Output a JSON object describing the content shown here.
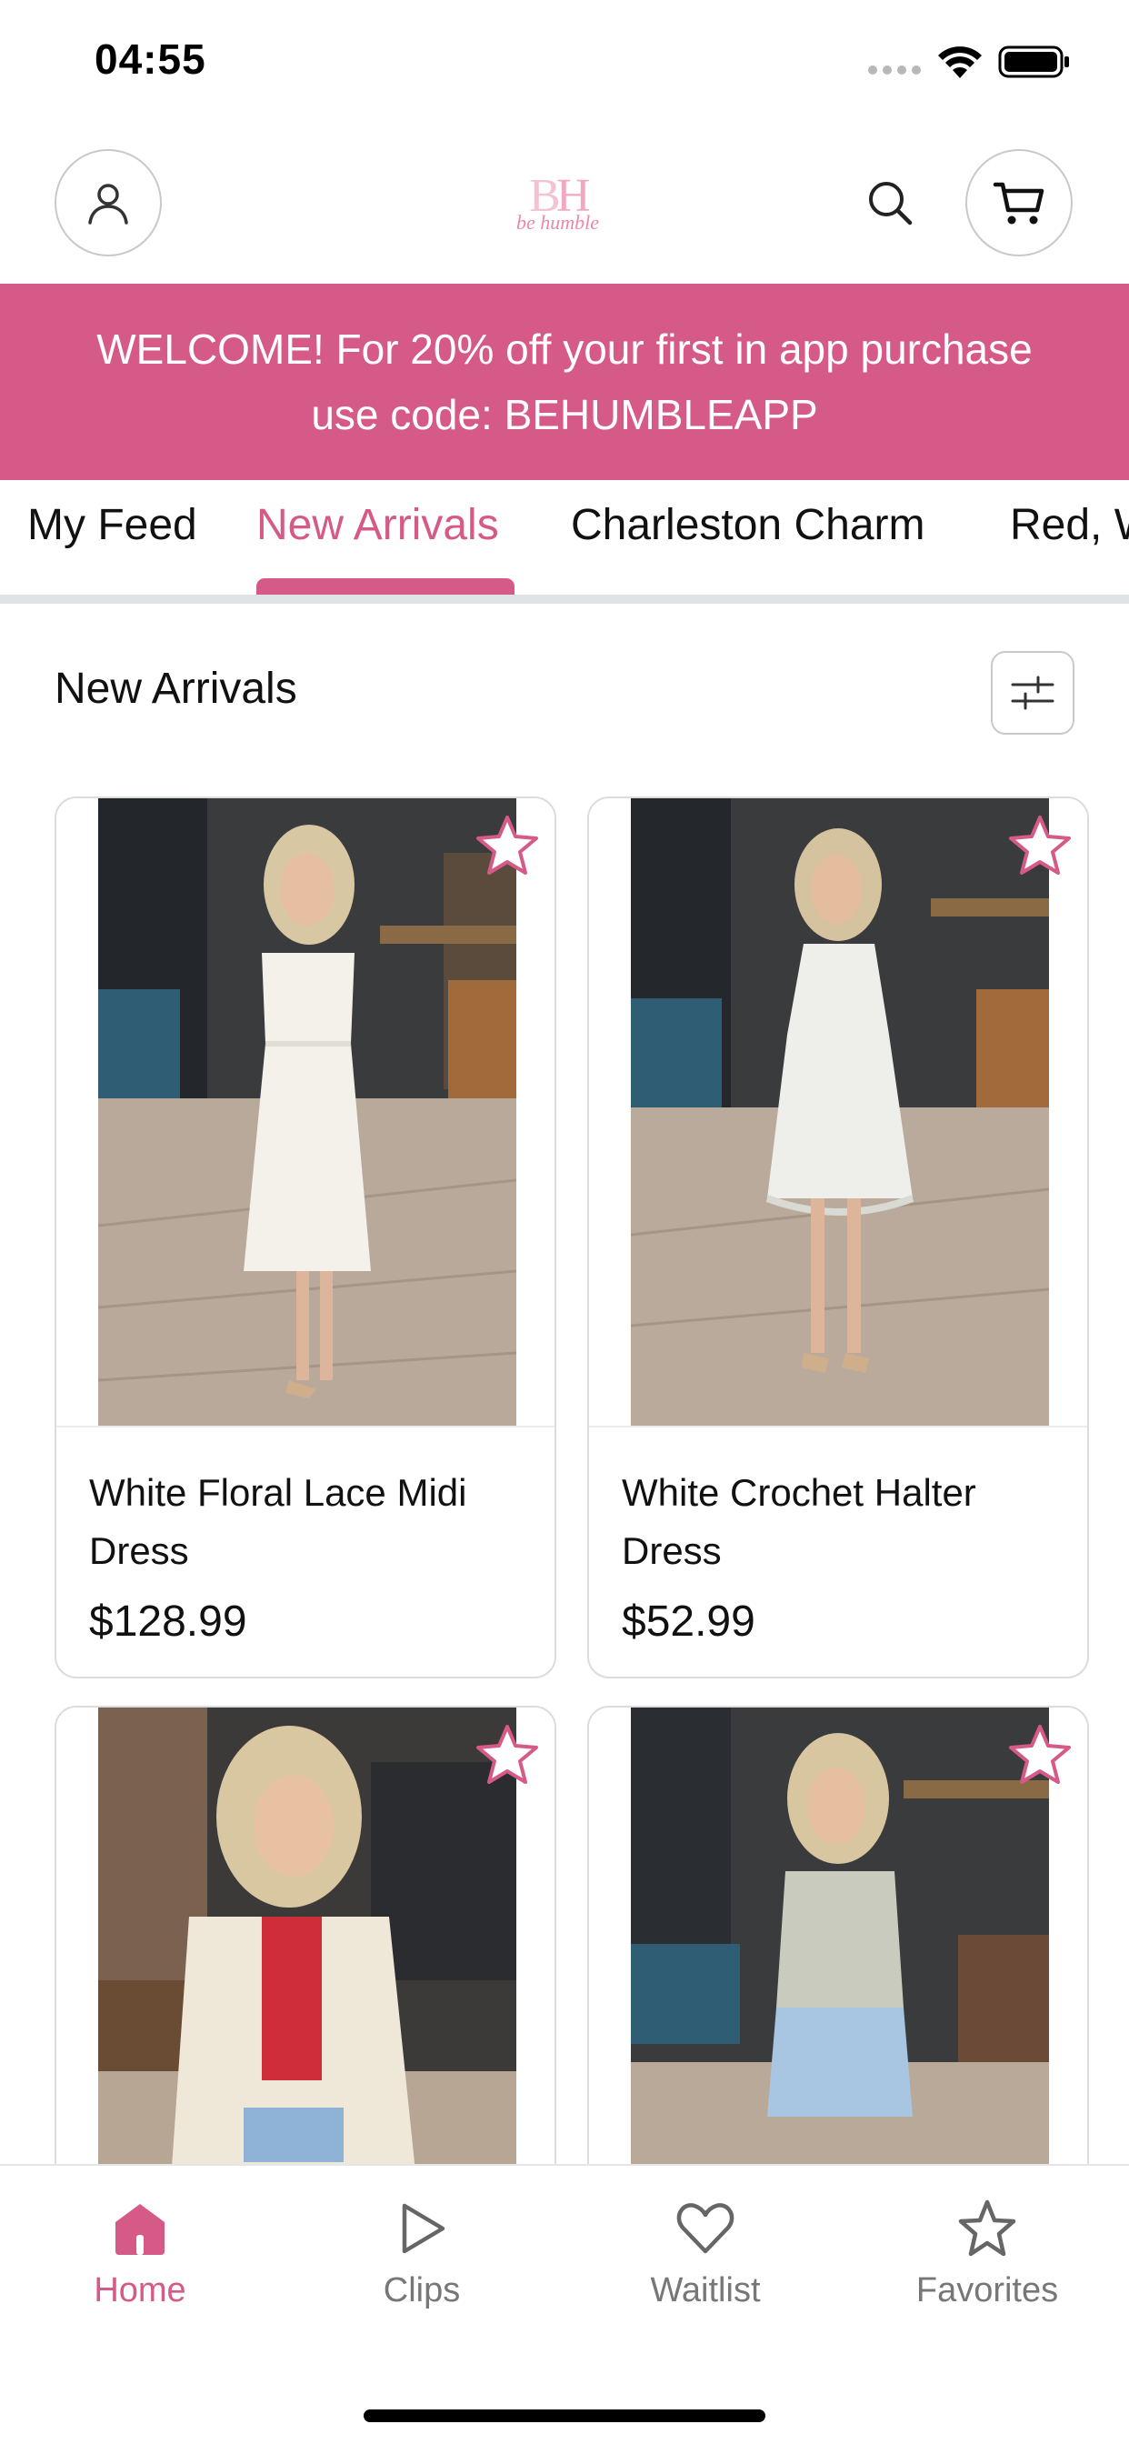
{
  "status_bar": {
    "time": "04:55"
  },
  "header": {
    "logo_text": "BH",
    "logo_script": "be humble",
    "accent_color": "#d65a87"
  },
  "promo": {
    "line1": "WELCOME! For 20% off your first in app purchase",
    "line2": "use code: BEHUMBLEAPP"
  },
  "tabs": [
    {
      "label": "My Feed",
      "active": false
    },
    {
      "label": "New Arrivals",
      "active": true
    },
    {
      "label": "Charleston Charm",
      "active": false
    },
    {
      "label": "Red, W",
      "active": false
    }
  ],
  "section": {
    "title": "New Arrivals"
  },
  "products": [
    {
      "name": "White Floral Lace Midi Dress",
      "price": "$128.99"
    },
    {
      "name": "White Crochet Halter Dress",
      "price": "$52.99"
    },
    {
      "name": "",
      "price": ""
    },
    {
      "name": "",
      "price": ""
    }
  ],
  "bottom_nav": [
    {
      "label": "Home",
      "icon": "home-icon",
      "active": true
    },
    {
      "label": "Clips",
      "icon": "play-icon",
      "active": false
    },
    {
      "label": "Waitlist",
      "icon": "heart-icon",
      "active": false
    },
    {
      "label": "Favorites",
      "icon": "star-icon",
      "active": false
    }
  ]
}
